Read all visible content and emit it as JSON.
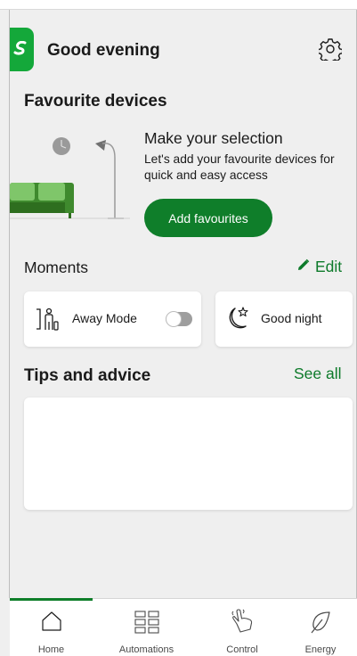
{
  "header": {
    "greeting": "Good evening",
    "logo_icon": "schneider-logo-icon",
    "settings_icon": "gear-icon",
    "brand_color": "#14a83a"
  },
  "favourites": {
    "title": "Favourite devices",
    "headline": "Make your selection",
    "description": "Let's add your favourite devices for quick and easy access",
    "button_label": "Add favourites",
    "button_color": "#0f7e2a"
  },
  "moments": {
    "title": "Moments",
    "edit_label": "Edit",
    "edit_icon": "pencil-icon",
    "items": [
      {
        "label": "Away Mode",
        "icon": "away-mode-icon",
        "toggle_on": false
      },
      {
        "label": "Good night",
        "icon": "moon-star-icon"
      }
    ]
  },
  "tips": {
    "title": "Tips and advice",
    "see_all_label": "See all"
  },
  "nav": {
    "active_index": 0,
    "items": [
      {
        "label": "Home",
        "icon": "home-icon"
      },
      {
        "label": "Automations",
        "icon": "automations-grid-icon"
      },
      {
        "label": "Control",
        "icon": "hand-tap-icon"
      },
      {
        "label": "Energy",
        "icon": "leaf-icon"
      }
    ]
  }
}
